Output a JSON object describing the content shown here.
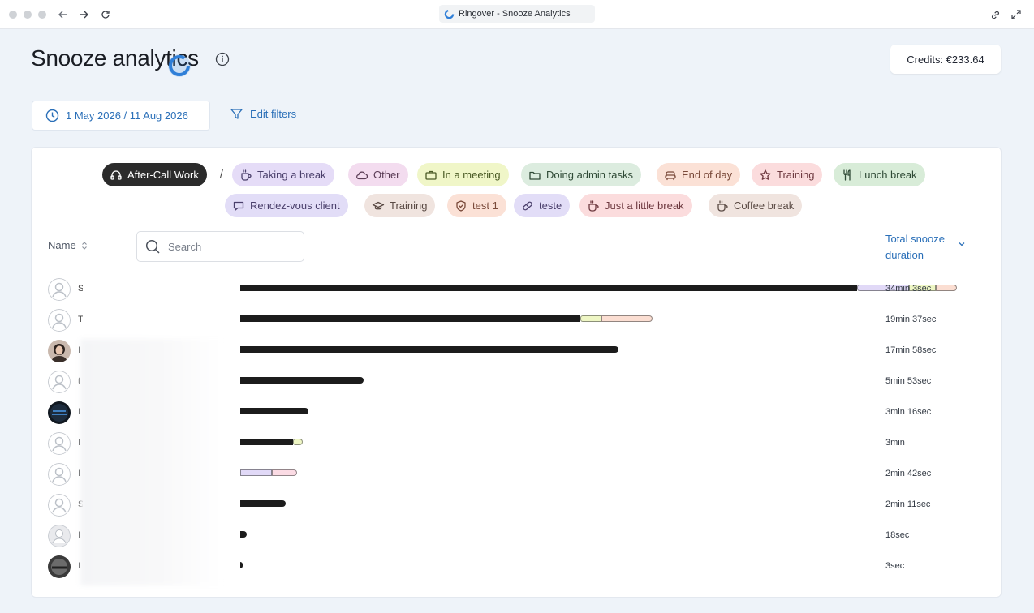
{
  "browser": {
    "tab_title": "Ringover - Snooze Analytics",
    "colors": {
      "tab_icon": "#2f7fd8"
    }
  },
  "page": {
    "title": "Snooze analytics",
    "credits": "Credits: €233.64",
    "date_range": "1 May 2026 / 11 Aug 2026",
    "edit_filters": "Edit filters"
  },
  "status_chips": [
    {
      "label": "After-Call Work",
      "icon": "headset-icon",
      "bg": "#2b2b2b",
      "fg": "#ffffff"
    },
    {
      "label": "Taking a break",
      "icon": "cup-icon",
      "bg": "#e5dcf7",
      "fg": "#4a3f6b"
    },
    {
      "label": "Other",
      "icon": "cloud-icon",
      "bg": "#f3dcef",
      "fg": "#5a3c55"
    },
    {
      "label": "In a meeting",
      "icon": "briefcase-icon",
      "bg": "#f0f6c8",
      "fg": "#4a5a24"
    },
    {
      "label": "Doing admin tasks",
      "icon": "folder-icon",
      "bg": "#dcecdf",
      "fg": "#2f4a36"
    },
    {
      "label": "End of day",
      "icon": "sofa-icon",
      "bg": "#fbe1d6",
      "fg": "#7a4a3a"
    },
    {
      "label": "Training",
      "icon": "star-icon",
      "bg": "#fbdcdd",
      "fg": "#6e3a40"
    },
    {
      "label": "Lunch break",
      "icon": "cutlery-icon",
      "bg": "#d8ecd8",
      "fg": "#2f4a36"
    },
    {
      "label": "Rendez-vous client",
      "icon": "chat-icon",
      "bg": "#e2ddf7",
      "fg": "#4a3f6b"
    },
    {
      "label": "Training",
      "icon": "graduation-cap-icon",
      "bg": "#f0e4df",
      "fg": "#5a4a44"
    },
    {
      "label": "test 1",
      "icon": "shield-icon",
      "bg": "#fbe1d6",
      "fg": "#7a4a3a"
    },
    {
      "label": "teste",
      "icon": "pill-icon",
      "bg": "#e2ddf7",
      "fg": "#4a3f6b"
    },
    {
      "label": "Just a little break",
      "icon": "cup-icon",
      "bg": "#fbdcdd",
      "fg": "#6e3a40"
    },
    {
      "label": "Coffee break",
      "icon": "cup-icon",
      "bg": "#f0e4df",
      "fg": "#5a4a44"
    }
  ],
  "table": {
    "name_header": "Name",
    "search_placeholder": "Search",
    "total_header": "Total snooze duration",
    "rows": [
      {
        "initial": "S",
        "avatar": "default-avatar",
        "duration": "34min 3sec",
        "bar_fraction": 0.864,
        "segments": [
          {
            "color": "#e1d9f7",
            "fraction": 0.072
          },
          {
            "color": "#eef6c4",
            "fraction": 0.038
          },
          {
            "color": "#fbded2",
            "fraction": 0.029
          }
        ]
      },
      {
        "initial": "T",
        "avatar": "default-avatar",
        "duration": "19min 37sec",
        "bar_fraction": 0.476,
        "segments": [
          {
            "color": "#eef6c4",
            "fraction": 0.03
          },
          {
            "color": "#fbded2",
            "fraction": 0.071
          }
        ]
      },
      {
        "initial": "I",
        "avatar": "photo-avatar-woman",
        "duration": "17min 58sec",
        "bar_fraction": 0.529,
        "segments": []
      },
      {
        "initial": "t",
        "avatar": "default-avatar",
        "duration": "5min 53sec",
        "bar_fraction": 0.173,
        "segments": []
      },
      {
        "initial": "I",
        "avatar": "photo-avatar-dark",
        "duration": "3min 16sec",
        "bar_fraction": 0.096,
        "segments": []
      },
      {
        "initial": "I",
        "avatar": "default-avatar",
        "duration": "3min",
        "bar_fraction": 0.074,
        "segments": [
          {
            "color": "#eef6c4",
            "fraction": 0.014
          }
        ]
      },
      {
        "initial": "I",
        "avatar": "default-avatar",
        "duration": "2min 42sec",
        "bar_fraction": 0.0,
        "segments": [
          {
            "color": "#e1d9f7",
            "fraction": 0.044
          },
          {
            "color": "#fbdbe4",
            "fraction": 0.035
          }
        ]
      },
      {
        "initial": "S",
        "avatar": "default-avatar",
        "duration": "2min 11sec",
        "bar_fraction": 0.064,
        "segments": []
      },
      {
        "initial": "I",
        "avatar": "default-avatar-grey",
        "duration": "18sec",
        "bar_fraction": 0.009,
        "segments": []
      },
      {
        "initial": "I",
        "avatar": "photo-avatar-dark2",
        "duration": "3sec",
        "bar_fraction": 0.002,
        "segments": []
      }
    ]
  }
}
